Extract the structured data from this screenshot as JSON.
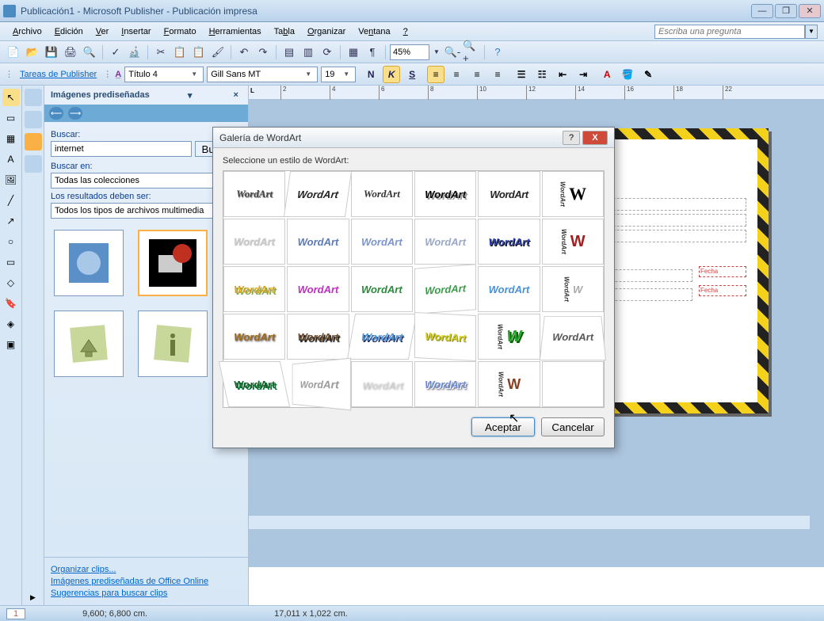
{
  "title": "Publicación1 - Microsoft Publisher - Publicación impresa",
  "menus": [
    "Archivo",
    "Edición",
    "Ver",
    "Insertar",
    "Formato",
    "Herramientas",
    "Tabla",
    "Organizar",
    "Ventana",
    "?"
  ],
  "help_placeholder": "Escriba una pregunta",
  "zoom": "45%",
  "tasks_label": "Tareas de Publisher",
  "style_name": "Título 4",
  "font_name": "Gill Sans MT",
  "font_size": "19",
  "clipart": {
    "title": "Imágenes prediseñadas",
    "search_label": "Buscar:",
    "search_value": "internet",
    "go": "Buscar",
    "search_in_label": "Buscar en:",
    "search_in_value": "Todas las colecciones",
    "results_label": "Los resultados deben ser:",
    "results_value": "Todos los tipos de archivos multimedia",
    "link1": "Organizar clips...",
    "link2": "Imágenes prediseñadas de Office Online",
    "link3": "Sugerencias para buscar clips"
  },
  "dialog": {
    "title": "Galería de WordArt",
    "prompt": "Seleccione un estilo de WordArt:",
    "ok": "Aceptar",
    "cancel": "Cancelar",
    "cell_text": "WordArt",
    "cell_w": "W"
  },
  "status": {
    "page": "1",
    "pos1": "9,600; 6,800 cm.",
    "pos2": "17,011 x 1,022 cm."
  },
  "ruler_ticks": [
    "2",
    "4",
    "6",
    "8",
    "10",
    "12",
    "14",
    "16",
    "18",
    "22"
  ],
  "ruler_letter": "L"
}
